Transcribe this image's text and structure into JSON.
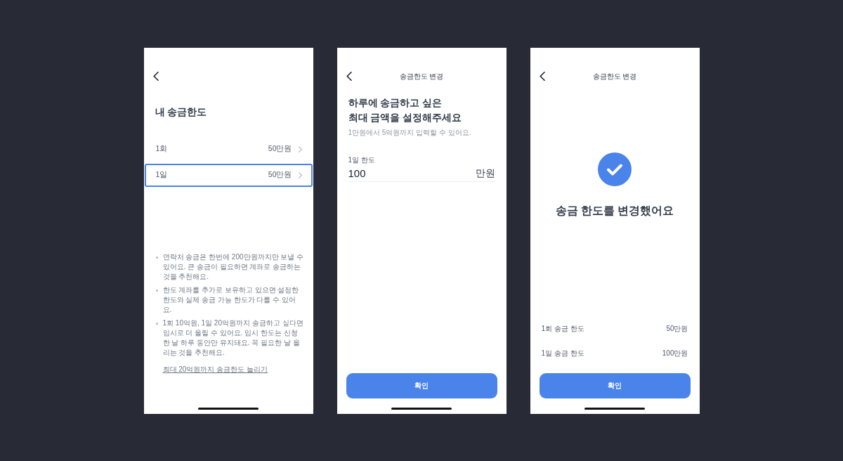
{
  "screens": [
    {
      "kind": "limit_list",
      "title": "내 송금한도",
      "rows": [
        {
          "label": "1회",
          "value": "50만원",
          "selected": false
        },
        {
          "label": "1일",
          "value": "50만원",
          "selected": true
        }
      ],
      "notes": [
        "연락처 송금은 한번에 200만원까지만 보낼 수 있어요. 큰 송금이 필요하면 계좌로 송금하는 것을 추천해요.",
        "한도 계좌를 추가로 보유하고 있으면 설정한 한도와 실제 송금 가능 한도가 다를 수 있어요.",
        "1회 10억원, 1일 20억원까지 송금하고 싶다면 임시로 더 올릴 수 있어요. 임시 한도는 신청한 날 하루 동안만 유지돼요. 꼭 필요한 날 올리는 것을 추천해요."
      ],
      "link": "최대 20억원까지 송금한도 늘리기"
    },
    {
      "kind": "amount_input",
      "header_title": "송금한도 변경",
      "heading": "하루에 송금하고 싶은\n최대 금액을 설정해주세요",
      "hint": "1만원에서 5억원까지 입력할 수 있어요.",
      "field": {
        "label": "1일 한도",
        "value": "100",
        "unit": "만원"
      },
      "button": "확인"
    },
    {
      "kind": "result",
      "header_title": "송금한도 변경",
      "message": "송금 한도를 변경했어요",
      "summary": [
        {
          "label": "1회 송금 한도",
          "value": "50만원"
        },
        {
          "label": "1일 송금 한도",
          "value": "100만원"
        }
      ],
      "button": "확인"
    }
  ]
}
